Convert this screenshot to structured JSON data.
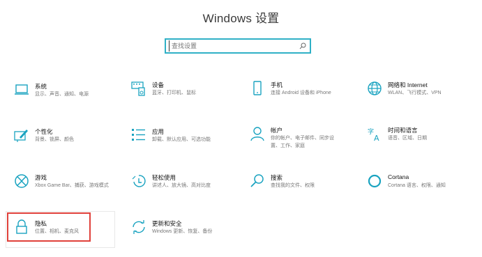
{
  "window": {
    "title": "Windows 设置"
  },
  "search": {
    "placeholder": "查找设置"
  },
  "tiles": [
    {
      "name": "系统",
      "desc": "显示、声音、通知、电源",
      "icon": "laptop-icon"
    },
    {
      "name": "设备",
      "desc": "蓝牙、打印机、鼠标",
      "icon": "devices-icon"
    },
    {
      "name": "手机",
      "desc": "连接 Android 设备和 iPhone",
      "icon": "phone-icon"
    },
    {
      "name": "网络和 Internet",
      "desc": "WLAN、飞行模式、VPN",
      "icon": "globe-icon"
    },
    {
      "name": "个性化",
      "desc": "背景、锁屏、颜色",
      "icon": "personalization-icon"
    },
    {
      "name": "应用",
      "desc": "卸载、默认应用、可选功能",
      "icon": "apps-icon"
    },
    {
      "name": "帐户",
      "desc": "你的帐户、电子邮件、同步设置、工作、家庭",
      "icon": "person-icon"
    },
    {
      "name": "时间和语言",
      "desc": "语音、区域、日期",
      "icon": "time-language-icon"
    },
    {
      "name": "游戏",
      "desc": "Xbox Game Bar、捕获、游戏模式",
      "icon": "xbox-icon"
    },
    {
      "name": "轻松使用",
      "desc": "讲述人、放大镜、高对比度",
      "icon": "ease-of-access-icon"
    },
    {
      "name": "搜索",
      "desc": "查找我的文件、权限",
      "icon": "search-icon"
    },
    {
      "name": "Cortana",
      "desc": "Cortana 语言、权限、通知",
      "icon": "cortana-icon"
    },
    {
      "name": "隐私",
      "desc": "位置、相机、麦克风",
      "icon": "lock-icon"
    },
    {
      "name": "更新和安全",
      "desc": "Windows 更新、恢复、备份",
      "icon": "update-icon"
    }
  ],
  "colors": {
    "accent": "#2fb0c6",
    "highlight": "#e0403a"
  }
}
